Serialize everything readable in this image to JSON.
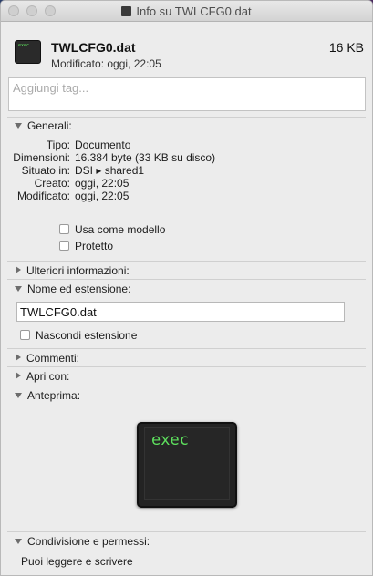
{
  "window": {
    "title": "Info su TWLCFG0.dat"
  },
  "header": {
    "file_name": "TWLCFG0.dat",
    "file_size": "16 KB",
    "modified": "Modificato:  oggi, 22:05",
    "icon_text": "exec"
  },
  "tags": {
    "placeholder": "Aggiungi tag..."
  },
  "general": {
    "label": "Generali:",
    "rows": [
      {
        "label": "Tipo:",
        "value": "Documento"
      },
      {
        "label": "Dimensioni:",
        "value": "16.384 byte (33 KB su disco)"
      },
      {
        "label": "Situato in:",
        "value": "DSI ▸ shared1"
      },
      {
        "label": "Creato:",
        "value": "oggi, 22:05"
      },
      {
        "label": "Modificato:",
        "value": "oggi, 22:05"
      }
    ],
    "template_label": "Usa come modello",
    "locked_label": "Protetto"
  },
  "more_info": {
    "label": "Ulteriori informazioni:"
  },
  "name_ext": {
    "label": "Nome ed estensione:",
    "value": "TWLCFG0.dat",
    "hide_ext_label": "Nascondi estensione"
  },
  "comments": {
    "label": "Commenti:"
  },
  "open_with": {
    "label": "Apri con:"
  },
  "preview": {
    "label": "Anteprima:",
    "text": "exec"
  },
  "sharing": {
    "label": "Condivisione e permessi:",
    "text": "Puoi leggere e scrivere"
  }
}
